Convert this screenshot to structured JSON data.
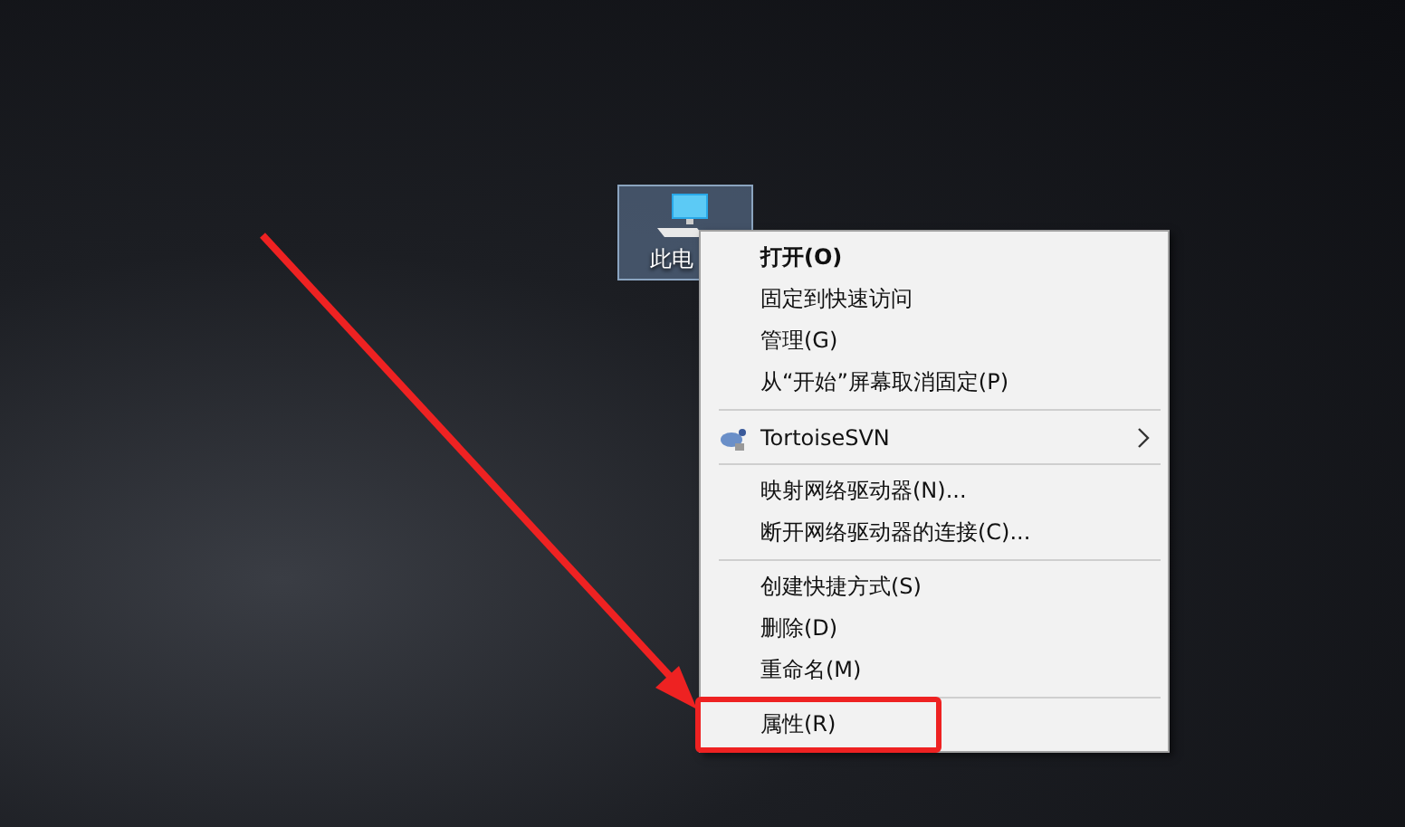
{
  "desktop_icon": {
    "label": "此电",
    "selected": true
  },
  "context_menu": {
    "groups": [
      [
        {
          "label": "打开(O)",
          "default": true,
          "submenu": false
        },
        {
          "label": "固定到快速访问",
          "default": false,
          "submenu": false
        },
        {
          "label": "管理(G)",
          "default": false,
          "submenu": false
        },
        {
          "label": "从“开始”屏幕取消固定(P)",
          "default": false,
          "submenu": false
        }
      ],
      [
        {
          "label": "TortoiseSVN",
          "default": false,
          "submenu": true
        }
      ],
      [
        {
          "label": "映射网络驱动器(N)...",
          "default": false,
          "submenu": false
        },
        {
          "label": "断开网络驱动器的连接(C)...",
          "default": false,
          "submenu": false
        }
      ],
      [
        {
          "label": "创建快捷方式(S)",
          "default": false,
          "submenu": false
        },
        {
          "label": "删除(D)",
          "default": false,
          "submenu": false
        },
        {
          "label": "重命名(M)",
          "default": false,
          "submenu": false
        }
      ],
      [
        {
          "label": "属性(R)",
          "default": false,
          "submenu": false
        }
      ]
    ]
  }
}
